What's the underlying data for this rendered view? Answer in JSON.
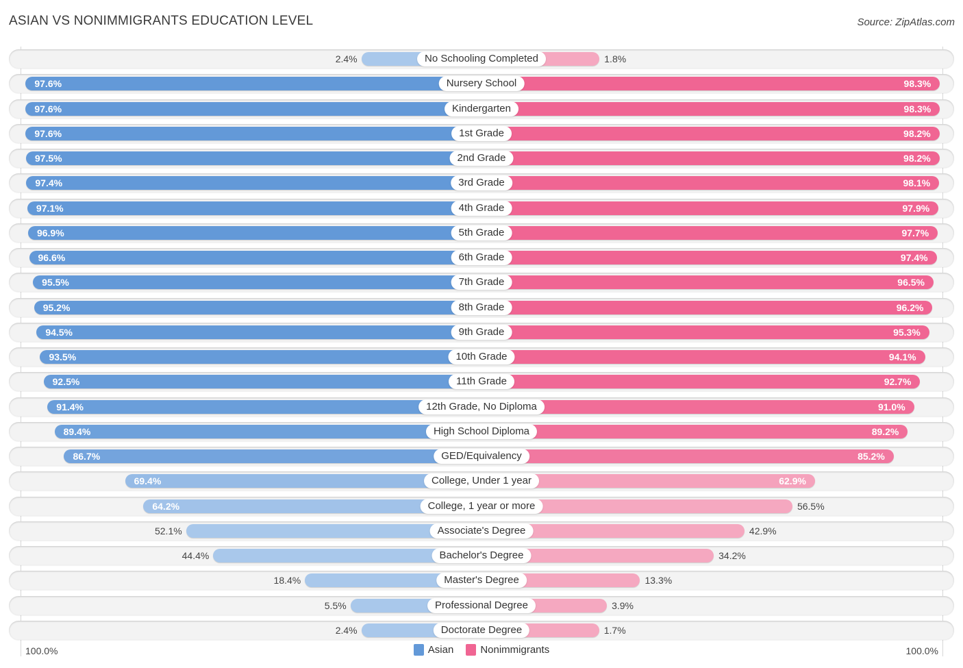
{
  "header": {
    "title": "ASIAN VS NONIMMIGRANTS EDUCATION LEVEL",
    "source": "Source: ZipAtlas.com"
  },
  "axis": {
    "left_label": "100.0%",
    "right_label": "100.0%"
  },
  "legend": [
    {
      "name": "Asian",
      "color": "#6399d8"
    },
    {
      "name": "Nonimmigrants",
      "color": "#f06593"
    }
  ],
  "colors": {
    "asian_strong": "#6399d8",
    "asian_light": "#a9c8eb",
    "nonimmigrants_strong": "#f06593",
    "nonimmigrants_light": "#f5a8c0"
  },
  "chart_data": {
    "type": "bar",
    "orientation": "horizontal-diverging",
    "title": "ASIAN VS NONIMMIGRANTS EDUCATION LEVEL",
    "xlabel": "",
    "ylabel": "",
    "xlim": [
      0,
      100
    ],
    "unit": "%",
    "legend_position": "bottom-center",
    "categories": [
      "No Schooling Completed",
      "Nursery School",
      "Kindergarten",
      "1st Grade",
      "2nd Grade",
      "3rd Grade",
      "4th Grade",
      "5th Grade",
      "6th Grade",
      "7th Grade",
      "8th Grade",
      "9th Grade",
      "10th Grade",
      "11th Grade",
      "12th Grade, No Diploma",
      "High School Diploma",
      "GED/Equivalency",
      "College, Under 1 year",
      "College, 1 year or more",
      "Associate's Degree",
      "Bachelor's Degree",
      "Master's Degree",
      "Professional Degree",
      "Doctorate Degree"
    ],
    "series": [
      {
        "name": "Asian",
        "side": "left",
        "values": [
          2.4,
          97.6,
          97.6,
          97.6,
          97.5,
          97.4,
          97.1,
          96.9,
          96.6,
          95.5,
          95.2,
          94.5,
          93.5,
          92.5,
          91.4,
          89.4,
          86.7,
          69.4,
          64.2,
          52.1,
          44.4,
          18.4,
          5.5,
          2.4
        ]
      },
      {
        "name": "Nonimmigrants",
        "side": "right",
        "values": [
          1.8,
          98.3,
          98.3,
          98.2,
          98.2,
          98.1,
          97.9,
          97.7,
          97.4,
          96.5,
          96.2,
          95.3,
          94.1,
          92.7,
          91.0,
          89.2,
          85.2,
          62.9,
          56.5,
          42.9,
          34.2,
          13.3,
          3.9,
          1.7
        ]
      }
    ]
  }
}
